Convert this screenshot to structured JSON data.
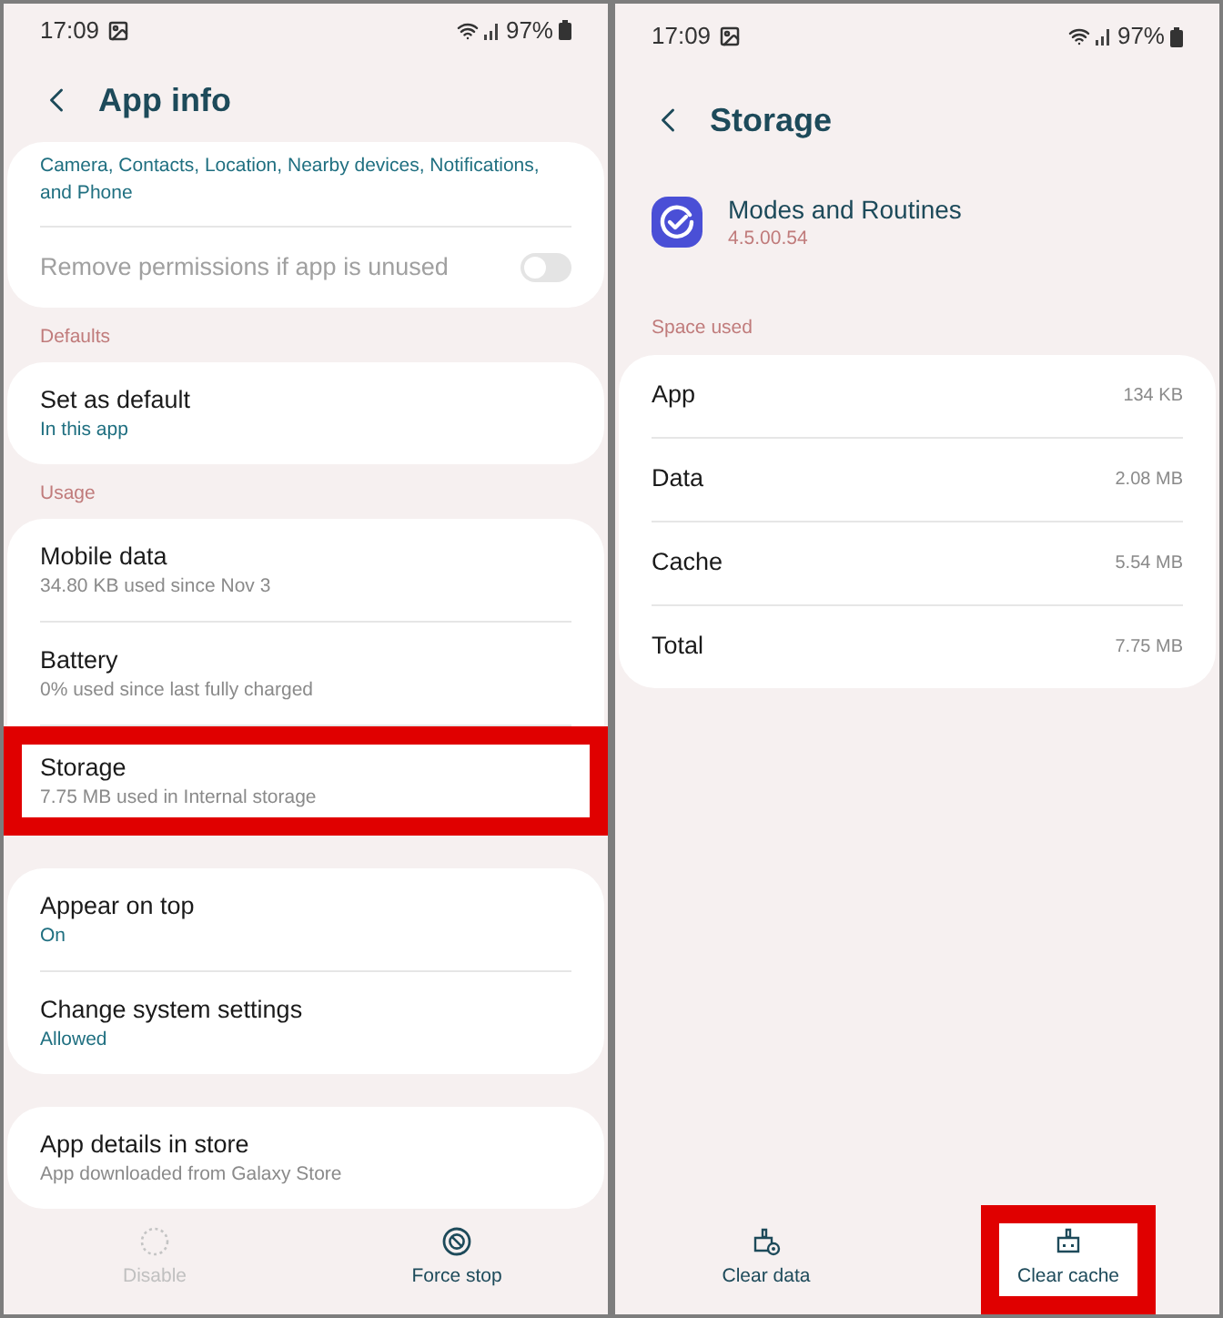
{
  "app_info": {
    "status_bar": {
      "time": "17:09",
      "battery": "97%"
    },
    "title": "App info",
    "sections": [
      {
        "items": [
          {
            "kind": "text",
            "subtitle": "Camera, Contacts, Location, Nearby devices, Notifications, and Phone",
            "accent": true,
            "highlighted": false
          },
          {
            "kind": "switch",
            "title": "Remove permissions if app is unused",
            "disabled": true,
            "on": false,
            "highlighted": false
          }
        ]
      },
      {
        "label": "Defaults",
        "items": [
          {
            "kind": "row",
            "title": "Set as default",
            "subtitle": "In this app",
            "accent": true,
            "highlighted": false
          }
        ]
      },
      {
        "label": "Usage",
        "items": [
          {
            "kind": "row",
            "title": "Mobile data",
            "subtitle": "34.80 KB used since Nov 3",
            "accent": false,
            "highlighted": false
          },
          {
            "kind": "row",
            "title": "Battery",
            "subtitle": "0% used since last fully charged",
            "accent": false,
            "highlighted": false
          },
          {
            "kind": "row",
            "title": "Storage",
            "subtitle": "7.75 MB used in Internal storage",
            "accent": false,
            "highlighted": true
          }
        ]
      },
      {
        "items": [
          {
            "kind": "row",
            "title": "Appear on top",
            "subtitle": "On",
            "accent": true,
            "highlighted": false
          },
          {
            "kind": "row",
            "title": "Change system settings",
            "subtitle": "Allowed",
            "accent": true,
            "highlighted": false
          }
        ]
      },
      {
        "items": [
          {
            "kind": "row",
            "title": "App details in store",
            "subtitle": "App downloaded from Galaxy Store",
            "accent": false,
            "highlighted": false
          }
        ]
      }
    ],
    "actions": [
      {
        "kind": "disable",
        "label": "Disable",
        "disabled": true,
        "highlighted": false
      },
      {
        "kind": "force_stop",
        "label": "Force stop",
        "disabled": false,
        "highlighted": false
      }
    ]
  },
  "storage": {
    "status_bar": {
      "time": "17:09",
      "battery": "97%"
    },
    "title": "Storage",
    "app": {
      "name": "Modes and Routines",
      "version": "4.5.00.54"
    },
    "space_label": "Space used",
    "rows": [
      {
        "label": "App",
        "value": "134 KB"
      },
      {
        "label": "Data",
        "value": "2.08 MB"
      },
      {
        "label": "Cache",
        "value": "5.54 MB"
      },
      {
        "label": "Total",
        "value": "7.75 MB"
      }
    ],
    "actions": [
      {
        "kind": "clear_data",
        "label": "Clear data",
        "disabled": false,
        "highlighted": false
      },
      {
        "kind": "clear_cache",
        "label": "Clear cache",
        "disabled": false,
        "highlighted": true
      }
    ]
  }
}
